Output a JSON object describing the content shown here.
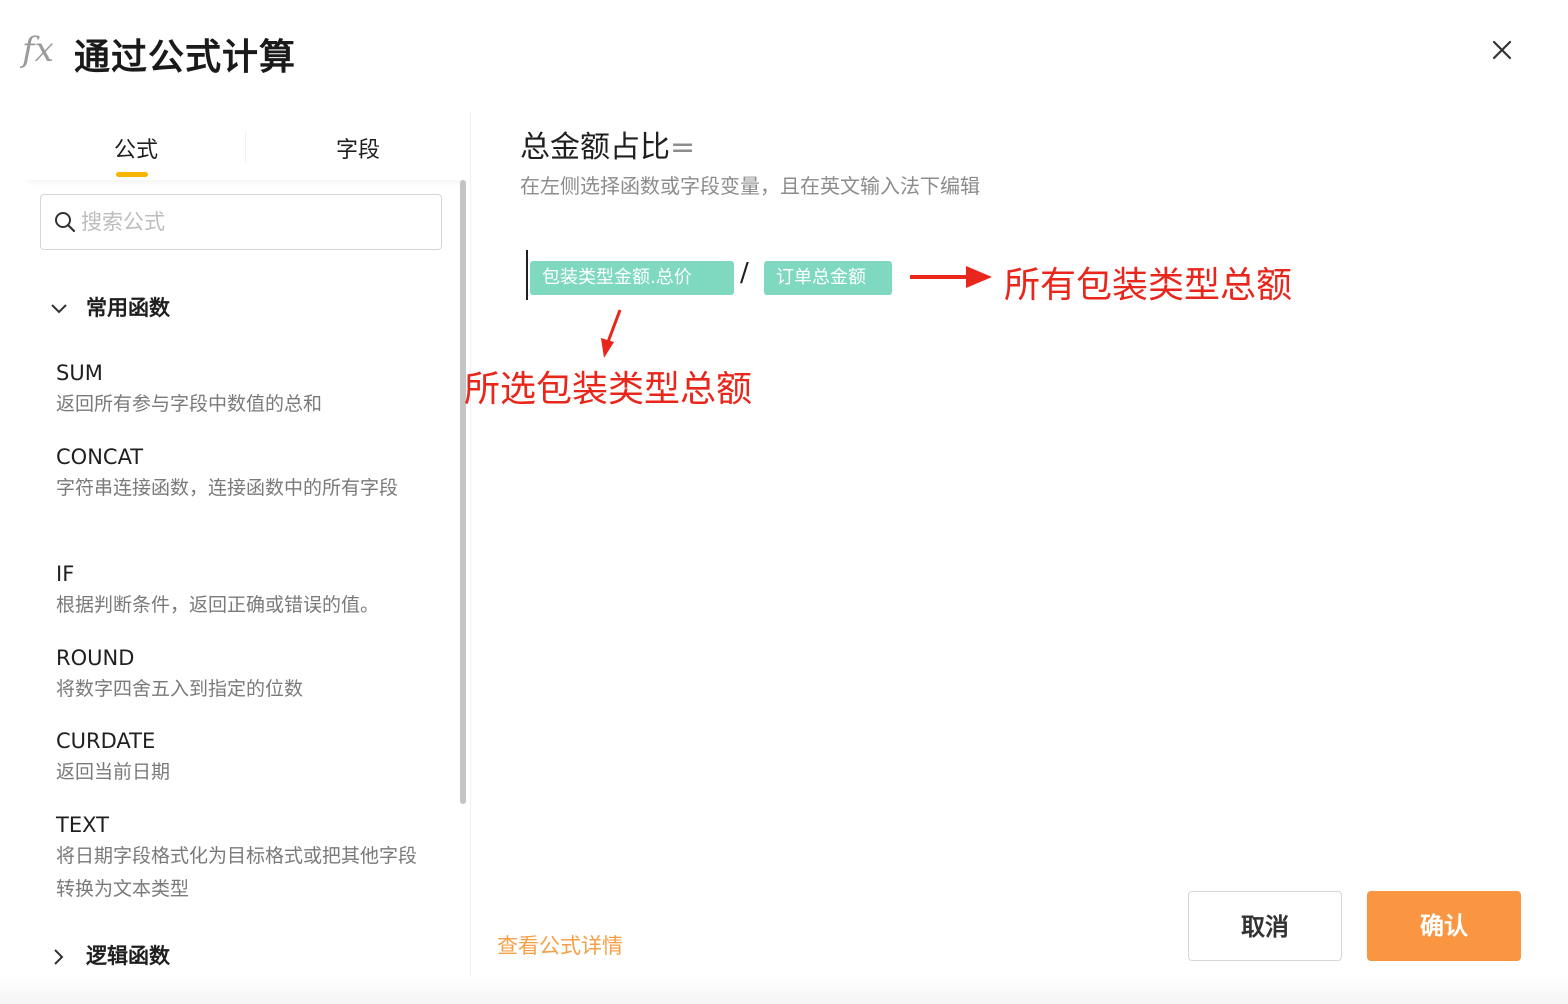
{
  "header": {
    "title": "通过公式计算",
    "icon": "fx-icon"
  },
  "tabs": [
    {
      "label": "公式",
      "active": true
    },
    {
      "label": "字段",
      "active": false
    }
  ],
  "search": {
    "placeholder": "搜索公式",
    "value": ""
  },
  "groups": [
    {
      "label": "常用函数",
      "expanded": true,
      "functions": [
        {
          "name": "SUM",
          "description": "返回所有参与字段中数值的总和"
        },
        {
          "name": "CONCAT",
          "description": "字符串连接函数，连接函数中的所有字段"
        },
        {
          "name": "IF",
          "description": "根据判断条件，返回正确或错误的值。"
        },
        {
          "name": "ROUND",
          "description": "将数字四舍五入到指定的位数"
        },
        {
          "name": "CURDATE",
          "description": "返回当前日期"
        },
        {
          "name": "TEXT",
          "description": "将日期字段格式化为目标格式或把其他字段转换为文本类型"
        }
      ]
    },
    {
      "label": "逻辑函数",
      "expanded": false
    }
  ],
  "editor": {
    "field_name": "总金额占比",
    "equals": "=",
    "hint": "在左侧选择函数或字段变量，且在英文输入法下编辑",
    "tokens": [
      {
        "type": "field",
        "label": "包装类型金额.总价"
      },
      {
        "type": "operator",
        "label": "/"
      },
      {
        "type": "field",
        "label": "订单总金额"
      }
    ]
  },
  "annotations": [
    {
      "text": "所有包装类型总额",
      "color": "#e8261c"
    },
    {
      "text": "所选包装类型总额",
      "color": "#e8261c"
    }
  ],
  "footer": {
    "details_link": "查看公式详情",
    "cancel_label": "取消",
    "confirm_label": "确认"
  },
  "colors": {
    "accent": "#fa9641",
    "tab_indicator": "#f7b500",
    "chip": "#7ed9c0",
    "annotation": "#e8261c",
    "link": "#f5a047"
  }
}
